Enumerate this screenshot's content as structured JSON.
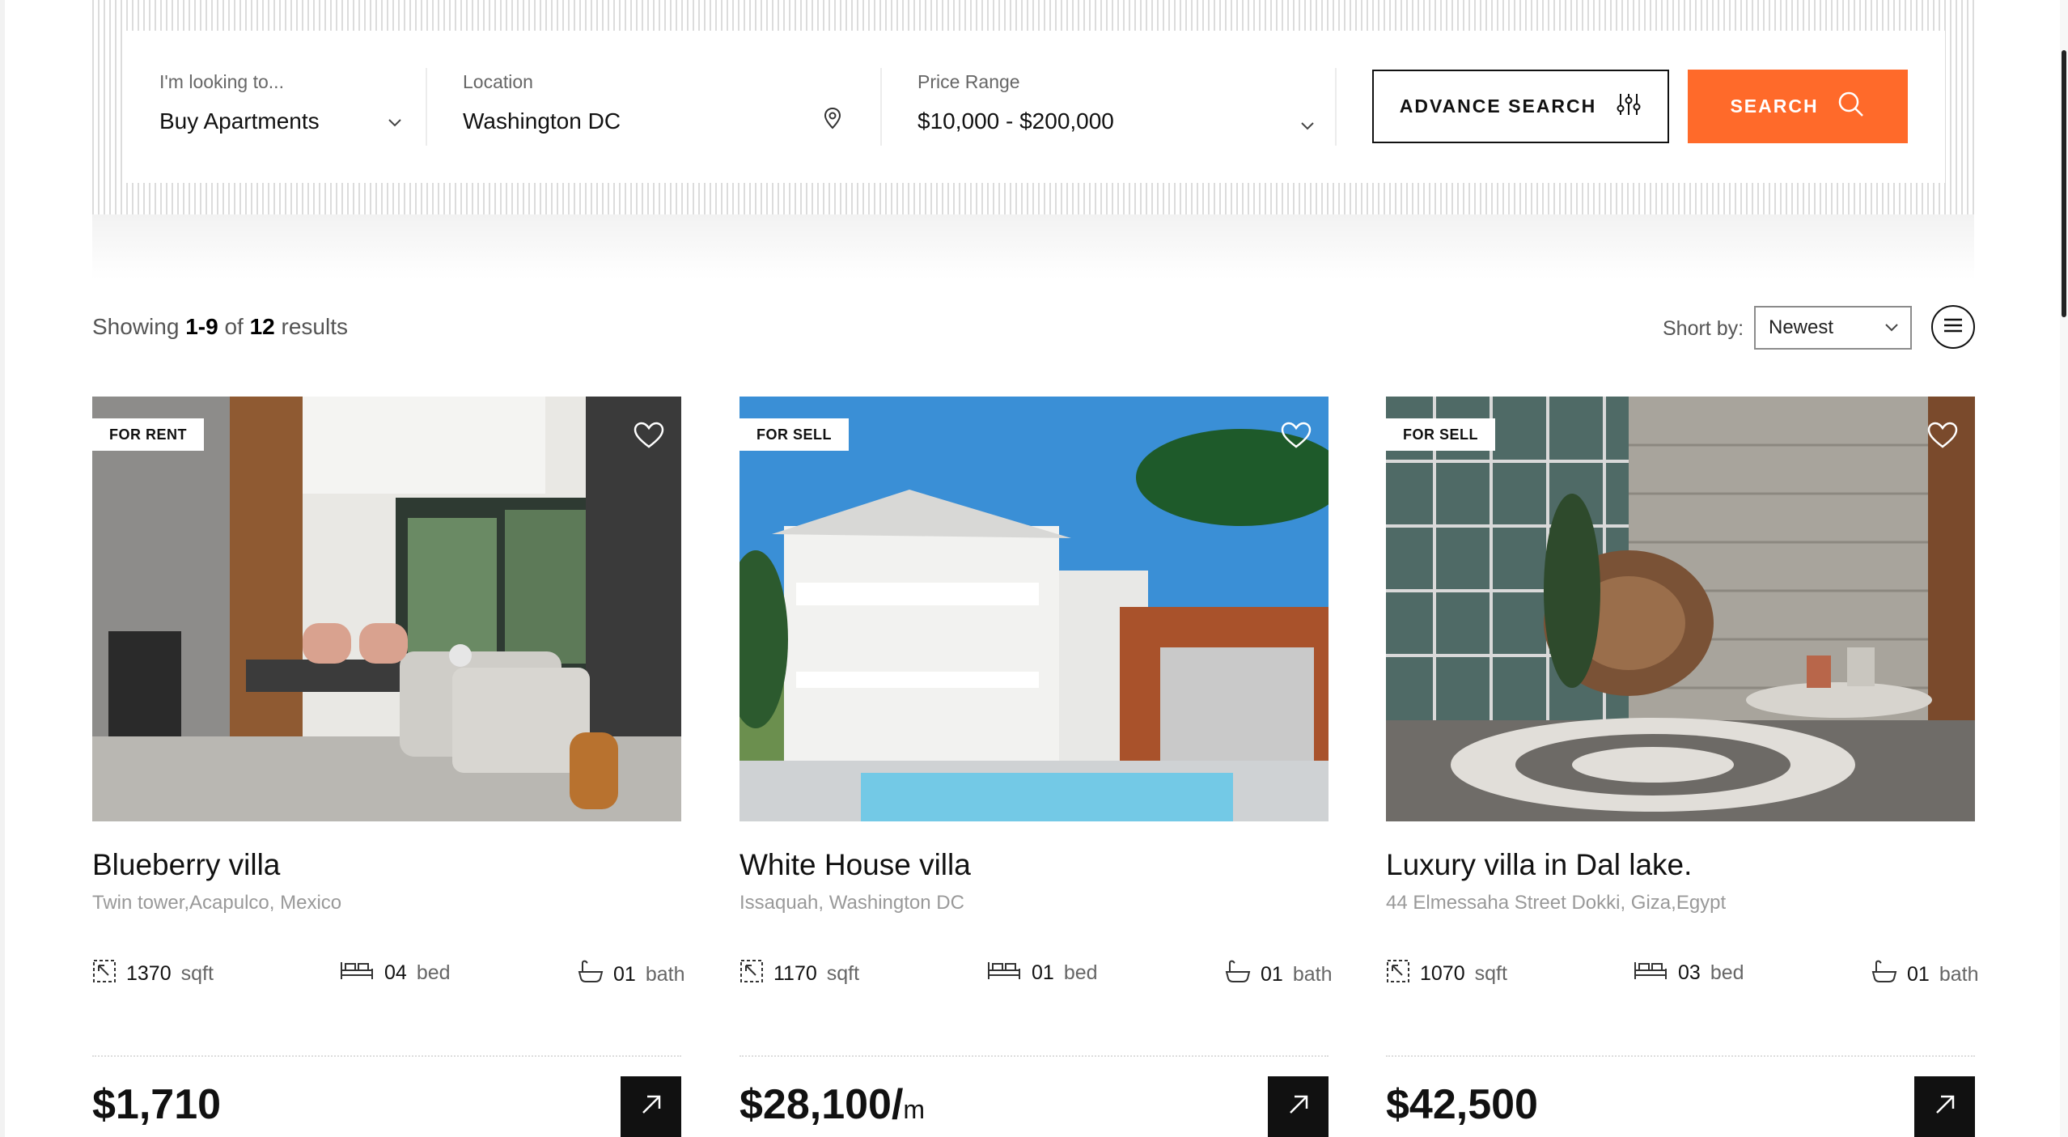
{
  "search": {
    "looking_label": "I'm looking to...",
    "looking_value": "Buy Apartments",
    "location_label": "Location",
    "location_value": "Washington DC",
    "price_label": "Price Range",
    "price_value": "$10,000 - $200,000",
    "advance_label": "ADVANCE SEARCH",
    "search_label": "SEARCH"
  },
  "results": {
    "prefix": "Showing",
    "range": "1-9",
    "of": "of",
    "total": "12",
    "suffix": "results",
    "sort_label": "Short by:",
    "sort_value": "Newest"
  },
  "listings": [
    {
      "tag": "FOR RENT",
      "title": "Blueberry villa",
      "address": "Twin tower,Acapulco, Mexico",
      "sqft": "1370",
      "sqft_unit": "sqft",
      "beds": "04",
      "beds_unit": "bed",
      "baths": "01",
      "baths_unit": "bath",
      "price": "$1,710",
      "price_unit": ""
    },
    {
      "tag": "FOR SELL",
      "title": "White House villa",
      "address": "Issaquah, Washington DC",
      "sqft": "1170",
      "sqft_unit": "sqft",
      "beds": "01",
      "beds_unit": "bed",
      "baths": "01",
      "baths_unit": "bath",
      "price": "$28,100/",
      "price_unit": "m"
    },
    {
      "tag": "FOR SELL",
      "title": "Luxury villa in Dal lake.",
      "address": "44 Elmessaha Street Dokki, Giza,Egypt",
      "sqft": "1070",
      "sqft_unit": "sqft",
      "beds": "03",
      "beds_unit": "bed",
      "baths": "01",
      "baths_unit": "bath",
      "price": "$42,500",
      "price_unit": ""
    }
  ],
  "colors": {
    "accent": "#ff6a2a",
    "dark": "#111111"
  }
}
